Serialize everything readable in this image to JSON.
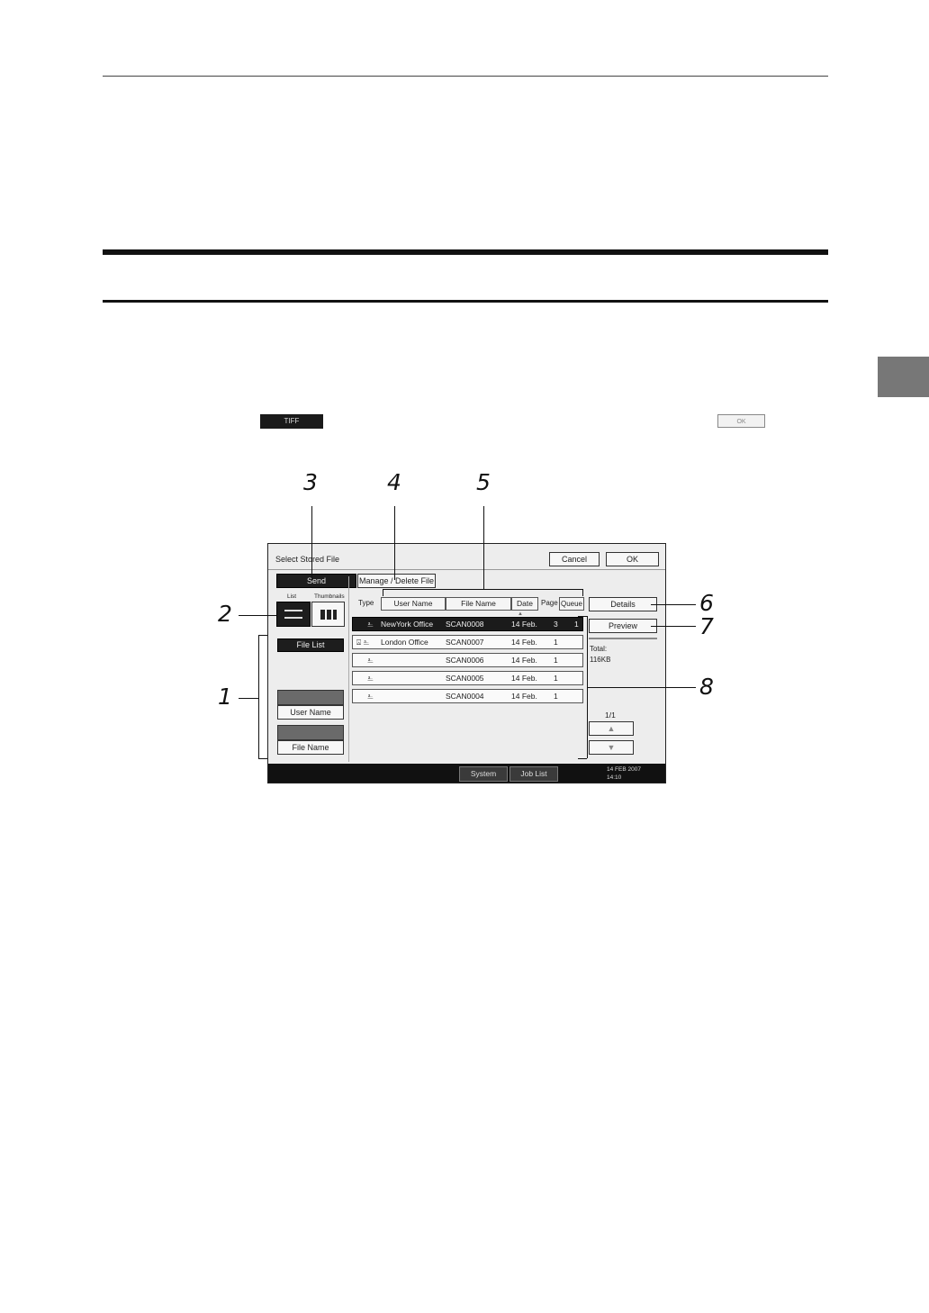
{
  "inline_buttons": {
    "tiff_label": "TIFF",
    "ok_label": "OK"
  },
  "callouts": [
    "1",
    "2",
    "3",
    "4",
    "5",
    "6",
    "7",
    "8"
  ],
  "screen": {
    "title": "Select Stored File",
    "cancel_label": "Cancel",
    "ok_label": "OK",
    "tabs": {
      "send": "Send",
      "manage": "Manage / Delete File"
    },
    "view_toggle": {
      "list_label": "List",
      "thumbnails_label": "Thumbnails"
    },
    "left_panel": {
      "file_list_label": "File List",
      "user_name_label": "User Name",
      "file_name_label": "File Name"
    },
    "columns": {
      "type": "Type",
      "user_name": "User Name",
      "file_name": "File Name",
      "date": "Date",
      "page": "Page",
      "queue": "Queue"
    },
    "rows": [
      {
        "icons": "⎁",
        "user": "NewYork Office",
        "file": "SCAN0008",
        "date": "14 Feb.",
        "page": "3",
        "queue": "1",
        "selected": true
      },
      {
        "icons": "⍓ ⎁",
        "user": "London Office",
        "file": "SCAN0007",
        "date": "14 Feb.",
        "page": "1",
        "queue": "",
        "selected": false
      },
      {
        "icons": "⎁",
        "user": "",
        "file": "SCAN0006",
        "date": "14 Feb.",
        "page": "1",
        "queue": "",
        "selected": false
      },
      {
        "icons": "⎁",
        "user": "",
        "file": "SCAN0005",
        "date": "14 Feb.",
        "page": "1",
        "queue": "",
        "selected": false
      },
      {
        "icons": "⎁",
        "user": "",
        "file": "SCAN0004",
        "date": "14 Feb.",
        "page": "1",
        "queue": "",
        "selected": false
      }
    ],
    "right_panel": {
      "details_label": "Details",
      "preview_label": "Preview",
      "total_label": "Total:",
      "total_value": "116KB",
      "page_indicator": "1/1"
    },
    "bottom_bar": {
      "system_status": "System Status",
      "job_list": "Job List",
      "date": "14 FEB  2007",
      "time": "14:10"
    }
  }
}
